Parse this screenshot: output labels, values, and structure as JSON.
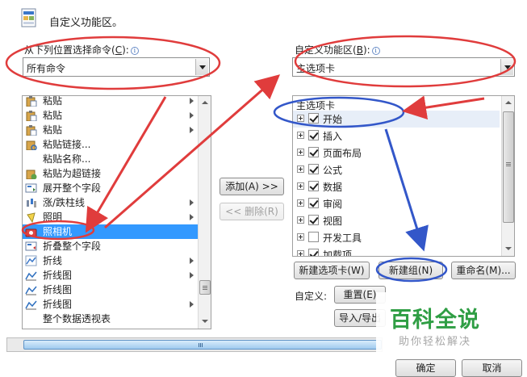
{
  "header": {
    "title": "自定义功能区。",
    "icon": "customize-ribbon-icon"
  },
  "left": {
    "label_text": "从下列位置选择命令",
    "label_key": "C",
    "combo_value": "所有命令",
    "items": [
      {
        "label": "粘贴",
        "icon": "paste-icon",
        "submenu": true
      },
      {
        "label": "粘贴",
        "icon": "paste-icon",
        "submenu": true
      },
      {
        "label": "粘贴",
        "icon": "paste-icon",
        "submenu": true
      },
      {
        "label": "粘贴链接...",
        "icon": "paste-link-icon",
        "submenu": false
      },
      {
        "label": "粘贴名称...",
        "icon": "",
        "submenu": false
      },
      {
        "label": "粘贴为超链接",
        "icon": "paste-hyperlink-icon",
        "submenu": false
      },
      {
        "label": "展开整个字段",
        "icon": "expand-field-icon",
        "submenu": false
      },
      {
        "label": "涨/跌柱线",
        "icon": "updown-bars-icon",
        "submenu": true
      },
      {
        "label": "照明",
        "icon": "lighting-icon",
        "submenu": true
      },
      {
        "label": "照相机",
        "icon": "camera-icon",
        "submenu": false,
        "selected": true
      },
      {
        "label": "折叠整个字段",
        "icon": "collapse-field-icon",
        "submenu": false
      },
      {
        "label": "折线",
        "icon": "line-icon",
        "submenu": true
      },
      {
        "label": "折线图",
        "icon": "line-chart-icon",
        "submenu": true
      },
      {
        "label": "折线图",
        "icon": "line-chart-icon",
        "submenu": false
      },
      {
        "label": "折线图",
        "icon": "line-chart-icon",
        "submenu": true
      },
      {
        "label": "整个数据透视表",
        "icon": "",
        "submenu": false
      }
    ]
  },
  "middle": {
    "add_label": "添加(A) >>",
    "remove_label": "<< 删除(R)"
  },
  "right": {
    "label_text": "自定义功能区",
    "label_key": "B",
    "combo_value": "主选项卡",
    "tree_header": "主选项卡",
    "tree_items": [
      {
        "label": "开始",
        "checked": true
      },
      {
        "label": "插入",
        "checked": true
      },
      {
        "label": "页面布局",
        "checked": true
      },
      {
        "label": "公式",
        "checked": true
      },
      {
        "label": "数据",
        "checked": true
      },
      {
        "label": "审阅",
        "checked": true
      },
      {
        "label": "视图",
        "checked": true
      },
      {
        "label": "开发工具",
        "checked": false
      },
      {
        "label": "加载项",
        "checked": true
      }
    ],
    "new_tab_label": "新建选项卡(W)",
    "new_group_label": "新建组(N)",
    "rename_label": "重命名(M)...",
    "customize_label": "自定义:",
    "reset_label": "重置(E)",
    "import_export_label": "导入/导出"
  },
  "footer": {
    "ok_label": "确定",
    "cancel_label": "取消"
  },
  "watermark": {
    "title": "百科全说",
    "subtitle": "助你轻松解决"
  },
  "colors": {
    "selection": "#3399ff",
    "annotation_red": "#e03c3c",
    "annotation_blue": "#3357c9",
    "watermark_green": "#2f9e44"
  }
}
